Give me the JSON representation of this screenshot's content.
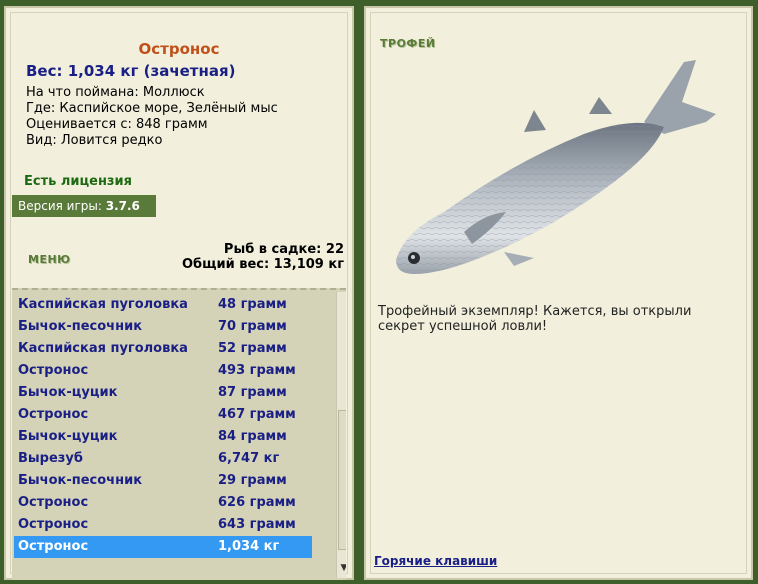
{
  "fish": {
    "title": "Остронос",
    "weight": "Вес: 1,034 кг (зачетная)",
    "bait": "На что поймана: Моллюск",
    "location": "Где: Каспийское море, Зелёный мыс",
    "rated_from": "Оценивается с: 848 грамм",
    "kind": "Вид: Ловится редко"
  },
  "license": "Есть лицензия",
  "version": {
    "label": "Версия игры:",
    "value": "3.7.6"
  },
  "menu_label": "МЕНЮ",
  "stats": {
    "fish_count": "Рыб в садке: 22",
    "total_weight": "Общий вес: 13,109 кг"
  },
  "catch_list": [
    {
      "name": "Каспийская пуголовка",
      "weight": "48 грамм"
    },
    {
      "name": "Бычок-песочник",
      "weight": "70 грамм"
    },
    {
      "name": "Каспийская пуголовка",
      "weight": "52 грамм"
    },
    {
      "name": "Остронос",
      "weight": "493 грамм"
    },
    {
      "name": "Бычок-цуцик",
      "weight": "87 грамм"
    },
    {
      "name": "Остронос",
      "weight": "467 грамм"
    },
    {
      "name": "Бычок-цуцик",
      "weight": "84 грамм"
    },
    {
      "name": "Вырезуб",
      "weight": "6,747 кг"
    },
    {
      "name": "Бычок-песочник",
      "weight": "29 грамм"
    },
    {
      "name": "Остронос",
      "weight": "626 грамм"
    },
    {
      "name": "Остронос",
      "weight": "643 грамм"
    },
    {
      "name": "Остронос",
      "weight": "1,034 кг"
    }
  ],
  "selected_index": 11,
  "trophy": {
    "label": "ТРОФЕЙ",
    "text": "Трофейный экземпляр! Кажется, вы открыли секрет успешной ловли!"
  },
  "hotkeys": "Горячие клавиши",
  "colors": {
    "accent_green": "#5a7a3a",
    "title_orange": "#c0501a",
    "list_text": "#1a1f86",
    "selection": "#3399f3"
  }
}
